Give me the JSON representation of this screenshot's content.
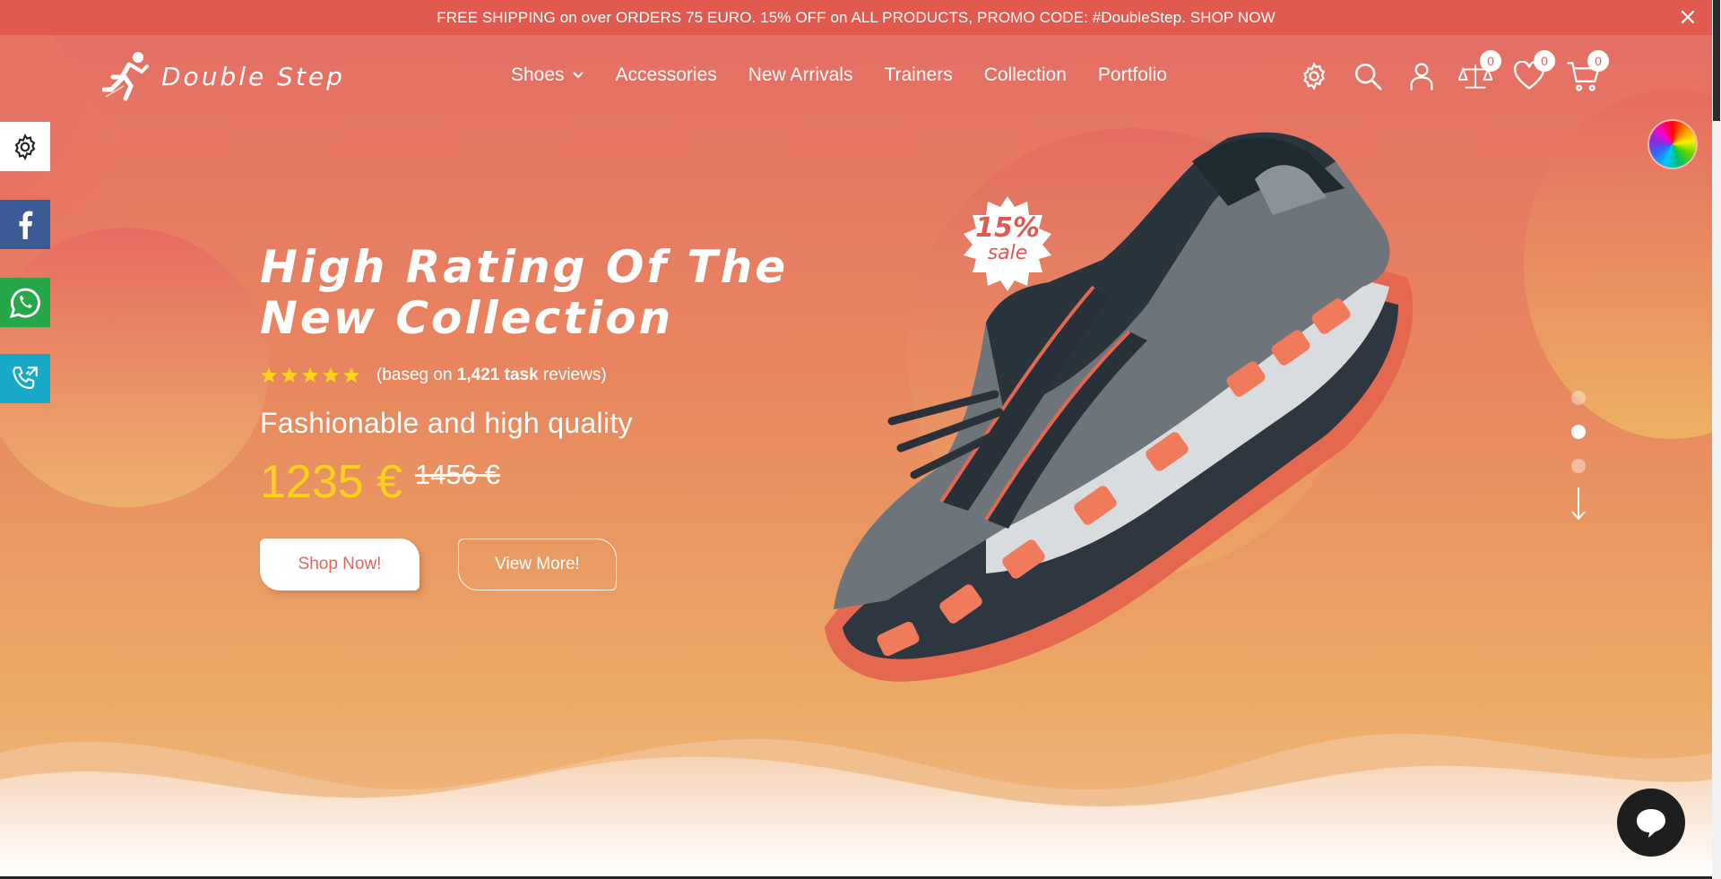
{
  "promo": {
    "text": "FREE SHIPPING on over ORDERS 75 EURO. 15% OFF on ALL PRODUCTS, PROMO CODE: #DoubleStep. SHOP NOW",
    "close_icon": "close-icon"
  },
  "brand": {
    "name": "Double Step",
    "logo_icon": "runner-icon"
  },
  "nav": {
    "items": [
      {
        "label": "Shoes",
        "has_dropdown": true
      },
      {
        "label": "Accessories"
      },
      {
        "label": "New Arrivals"
      },
      {
        "label": "Trainers"
      },
      {
        "label": "Collection"
      },
      {
        "label": "Portfolio"
      }
    ]
  },
  "header_icons": {
    "settings": "gear-icon",
    "search": "search-icon",
    "account": "user-icon",
    "compare": {
      "icon": "scale-icon",
      "count": "0"
    },
    "wishlist": {
      "icon": "heart-icon",
      "count": "0"
    },
    "cart": {
      "icon": "cart-icon",
      "count": "0"
    }
  },
  "side_bar": {
    "items": [
      "gear-icon",
      "facebook-icon",
      "whatsapp-icon",
      "phone-call-icon"
    ]
  },
  "hero": {
    "title_line1": "High Rating Of The",
    "title_line2": "New Collection",
    "rating": {
      "stars": 5,
      "prefix": "(baseg on ",
      "count": "1,421 task",
      "suffix": " reviews)"
    },
    "subtitle": "Fashionable and high quality",
    "price_now": "1235 €",
    "price_old": "1456 €",
    "shop_button": "Shop Now!",
    "view_button": "View More!"
  },
  "sale_badge": {
    "percent": "15%",
    "word": "sale"
  },
  "slider": {
    "dots": 3,
    "active_index": 1,
    "scroll_icon": "arrow-down-icon"
  },
  "chat": {
    "icon": "chat-bubble-icon"
  },
  "colors": {
    "promo_bg": "#e15a4f",
    "accent": "#e2665c",
    "price": "#ffd21c",
    "facebook": "#3b5b97",
    "whatsapp": "#26a84a",
    "call": "#18a8c8"
  }
}
